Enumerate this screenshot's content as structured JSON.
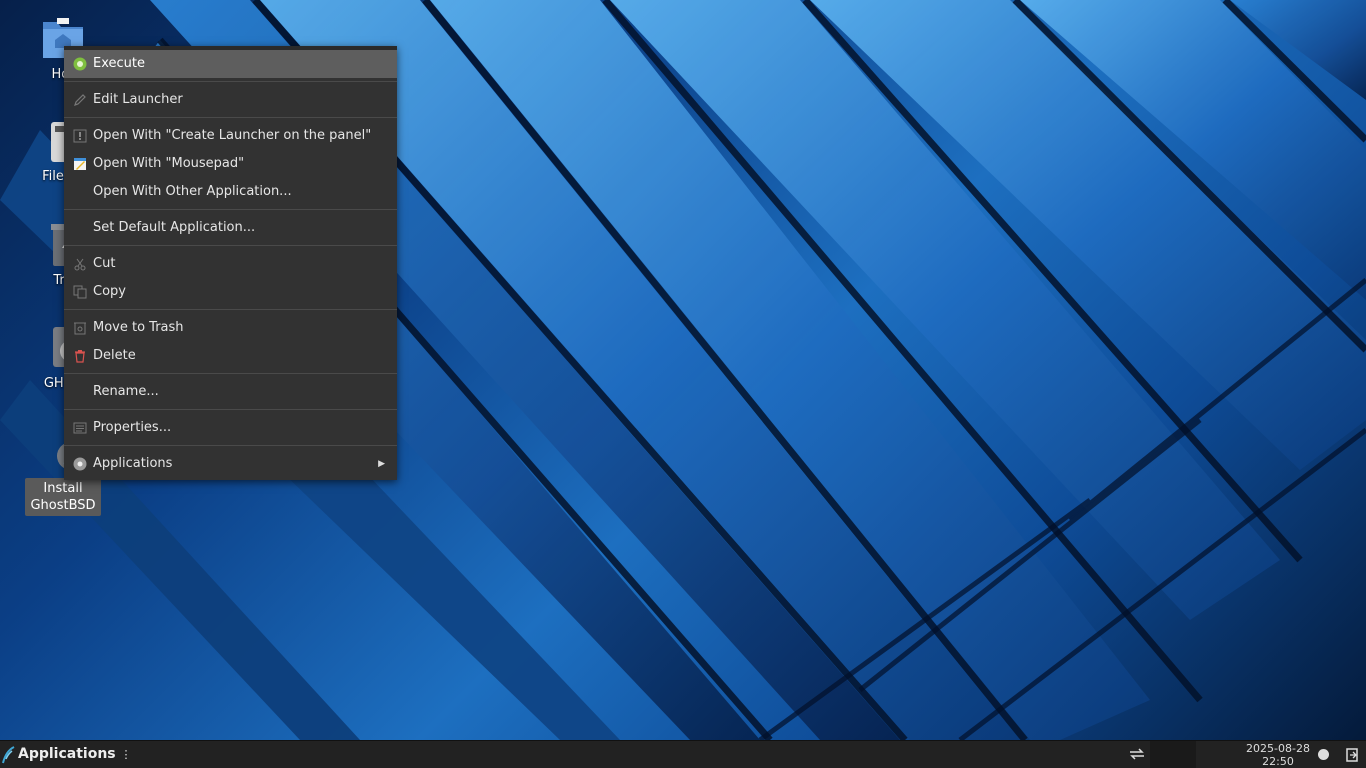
{
  "desktop": {
    "icons": [
      {
        "label": "Hor",
        "icon": "home-folder-icon"
      },
      {
        "label": "File Sy",
        "icon": "filesystem-drive-icon"
      },
      {
        "label": "Tra",
        "icon": "trash-icon"
      },
      {
        "label": "GHOS",
        "icon": "optical-disc-icon"
      },
      {
        "label": "Install GhostBSD",
        "icon": "ghostbsd-installer-icon"
      }
    ]
  },
  "context_menu": {
    "items": {
      "execute": "Execute",
      "edit_launcher": "Edit Launcher",
      "open_with_create_launcher": "Open With \"Create Launcher on the panel\"",
      "open_with_mousepad": "Open With \"Mousepad\"",
      "open_with_other": "Open With Other Application...",
      "set_default": "Set Default Application...",
      "cut": "Cut",
      "copy": "Copy",
      "move_to_trash": "Move to Trash",
      "delete": "Delete",
      "rename": "Rename...",
      "properties": "Properties...",
      "applications": "Applications"
    }
  },
  "taskbar": {
    "applications_label": "Applications",
    "clock_date": "2025-08-28",
    "clock_time": "22:50"
  },
  "colors": {
    "menu_bg": "#323232",
    "menu_active": "#5e5e5e",
    "taskbar_bg": "#222222",
    "wallpaper_blue": "#1d6fc0"
  }
}
